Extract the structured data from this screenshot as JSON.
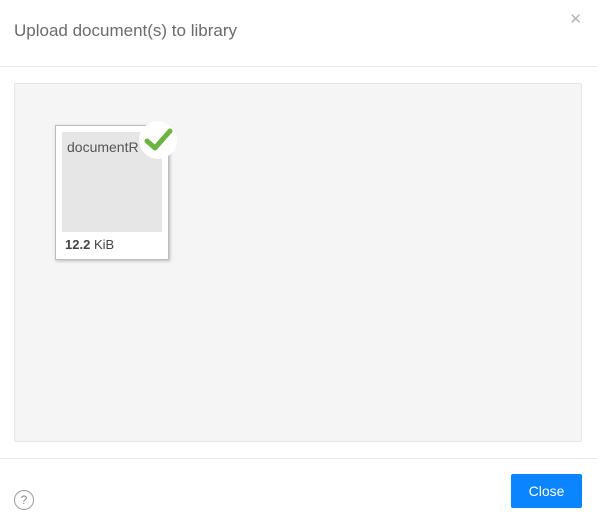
{
  "dialog": {
    "title": "Upload document(s) to library",
    "close_icon": "close-icon"
  },
  "file": {
    "name": "documentR",
    "size_value": "12.2",
    "size_unit": "KiB",
    "status_icon": "checkmark-icon",
    "status_color": "#6db33f"
  },
  "footer": {
    "help_glyph": "?",
    "help_icon": "help-icon",
    "close_label": "Close",
    "accent": "#0a84ff"
  }
}
